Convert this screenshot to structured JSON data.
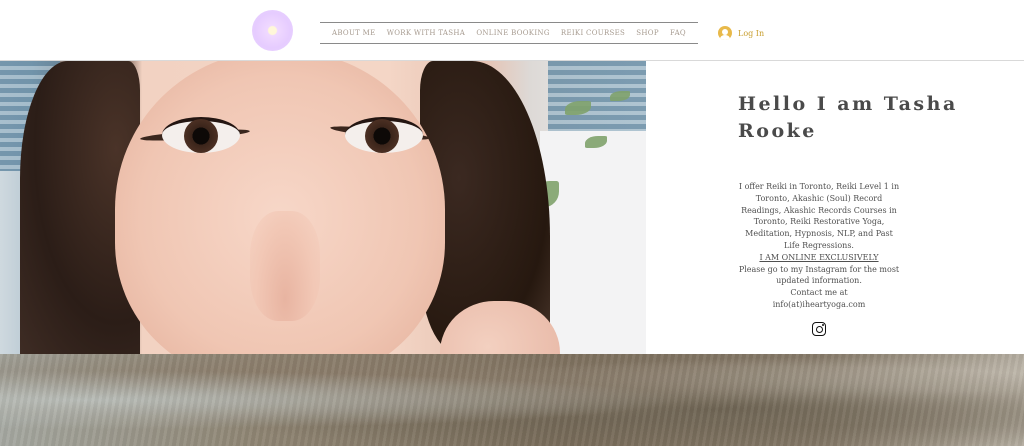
{
  "header": {
    "logo_icon": "mandala-logo-icon",
    "nav": [
      {
        "label": "ABOUT ME"
      },
      {
        "label": "WORK WITH TASHA"
      },
      {
        "label": "ONLINE BOOKING"
      },
      {
        "label": "REIKI COURSES"
      },
      {
        "label": "SHOP"
      },
      {
        "label": "FAQ"
      }
    ],
    "login": {
      "label": "Log In",
      "icon": "user-avatar-icon"
    }
  },
  "hero": {
    "image_alt": "portrait photo"
  },
  "intro": {
    "title": "Hello I am Tasha Rooke",
    "paragraph": "I offer Reiki in Toronto, Reiki Level 1 in Toronto, Akashic (Soul) Record Readings, Akashic Records Courses in Toronto, Reiki Restorative Yoga, Meditation, Hypnosis, NLP, and Past Life Regressions.",
    "online_link": "I AM ONLINE EXCLUSIVELY",
    "instagram_note": "Please go to my Instagram for the most updated information.",
    "contact_label": "Contact me at",
    "contact_email": "info(at)iheartyoga.com",
    "social_icon": "instagram-icon"
  },
  "colors": {
    "nav_text": "#a69a8f",
    "login_accent": "#c9a032",
    "logo": "#e6ccff"
  }
}
